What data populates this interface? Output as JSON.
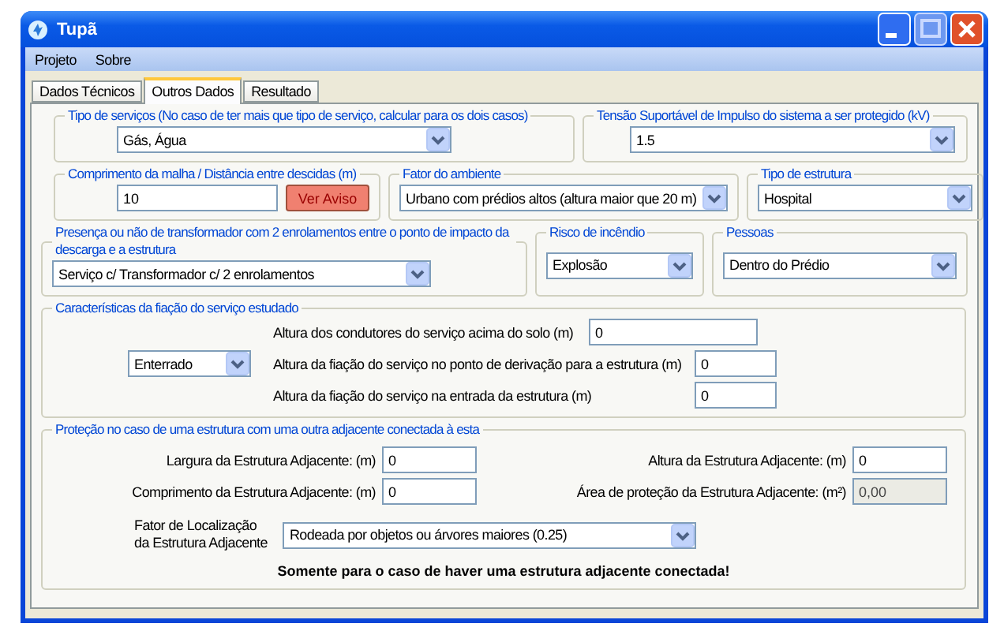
{
  "window": {
    "title": "Tupã"
  },
  "menu": [
    "Projeto",
    "Sobre"
  ],
  "tabs": [
    {
      "label": "Dados Técnicos",
      "selected": false
    },
    {
      "label": "Outros Dados",
      "selected": true
    },
    {
      "label": "Resultado",
      "selected": false
    }
  ],
  "service_type": {
    "legend": "Tipo de serviços (No caso de ter mais que tipo de serviço, calcular para os dois casos)",
    "value": "Gás, Água"
  },
  "impulse_voltage": {
    "legend": "Tensão Suportável de Impulso do sistema a ser protegido (kV)",
    "value": "1.5"
  },
  "mesh_length": {
    "legend": "Comprimento da malha / Distância entre descidas (m)",
    "value": "10",
    "button": "Ver Aviso"
  },
  "environment_factor": {
    "legend": "Fator do ambiente",
    "value": "Urbano com prédios altos (altura maior que 20 m)"
  },
  "structure_type": {
    "legend": "Tipo de estrutura",
    "value": "Hospital"
  },
  "transformer": {
    "legend": "Presença ou não de transformador com 2 enrolamentos entre o ponto de impacto da descarga e a estrutura",
    "value": "Serviço c/ Transformador c/ 2 enrolamentos"
  },
  "fire_risk": {
    "legend": "Risco de incêndio",
    "value": "Explosão"
  },
  "people": {
    "legend": "Pessoas",
    "value": "Dentro do Prédio"
  },
  "wiring": {
    "legend": "Características da fiação do serviço estudado",
    "type_value": "Enterrado",
    "fields": [
      {
        "label": "Altura dos condutores do serviço acima do solo (m)",
        "value": "0"
      },
      {
        "label": "Altura da fiação do serviço no ponto de derivação para a estrutura (m)",
        "value": "0"
      },
      {
        "label": "Altura da fiação do serviço na entrada da estrutura (m)",
        "value": "0"
      }
    ]
  },
  "adjacent": {
    "legend": "Proteção no caso de uma estrutura com uma outra adjacente conectada à esta",
    "fields": [
      {
        "label": "Largura da Estrutura Adjacente: (m)",
        "value": "0",
        "disabled": false
      },
      {
        "label": "Altura da Estrutura Adjacente: (m)",
        "value": "0",
        "disabled": false
      },
      {
        "label": "Comprimento da Estrutura Adjacente: (m)",
        "value": "0",
        "disabled": false
      },
      {
        "label": "Área de proteção da Estrutura Adjacente: (m²)",
        "value": "0,00",
        "disabled": true
      }
    ],
    "location_label": [
      "Fator de Localização",
      "da Estrutura Adjacente"
    ],
    "location_value": "Rodeada por objetos ou árvores maiores (0.25)",
    "note": "Somente para o caso de haver uma estrutura adjacente conectada!"
  }
}
